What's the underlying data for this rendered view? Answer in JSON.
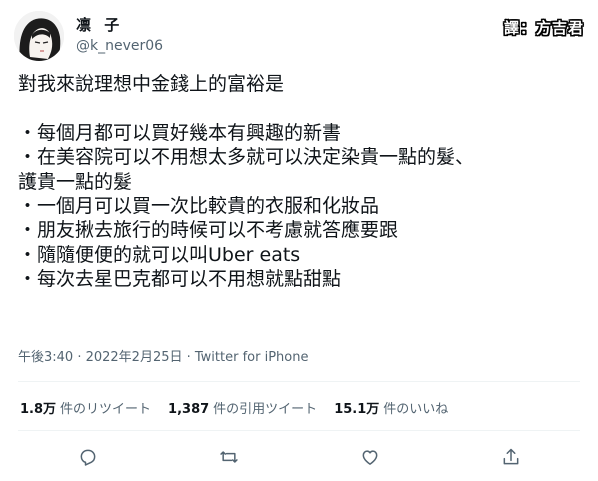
{
  "user": {
    "display_name": "凛 子",
    "handle": "@k_never06"
  },
  "translator_credit": "譯：方吉君",
  "tweet": {
    "lines": [
      "對我來說理想中金錢上的富裕是",
      "",
      "・每個月都可以買好幾本有興趣的新書",
      "・在美容院可以不用想太多就可以決定染貴一點的髮、",
      "護貴一點的髮",
      "・一個月可以買一次比較貴的衣服和化妝品",
      "・朋友揪去旅行的時候可以不考慮就答應要跟",
      "・隨隨便便的就可以叫Uber eats",
      "・每次去星巴克都可以不用想就點甜點"
    ]
  },
  "meta": "午後3:40 · 2022年2月25日 · Twitter for iPhone",
  "stats": {
    "retweets_count": "1.8万",
    "retweets_label": "件のリツイート",
    "quotes_count": "1,387",
    "quotes_label": "件の引用ツイート",
    "likes_count": "15.1万",
    "likes_label": "件のいいね"
  },
  "icons": [
    "reply-icon",
    "retweet-icon",
    "like-icon",
    "share-icon"
  ]
}
